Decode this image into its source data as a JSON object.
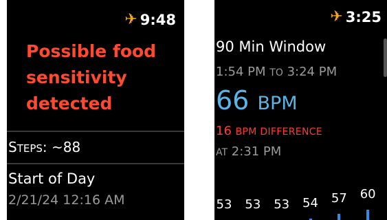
{
  "left": {
    "status_time": "9:48",
    "alert_line1": "Possible food",
    "alert_line2": "sensitivity",
    "alert_line3": "detected",
    "steps_label_first": "S",
    "steps_label_rest": "TEPS",
    "steps_value": ": ~88",
    "start_label": "Start of Day",
    "start_date": "2/21/24  12:16 AM"
  },
  "right": {
    "status_time": "3:25",
    "window_title": "90 Min Window",
    "range_start": "1:54 PM",
    "range_to": "TO",
    "range_end": "3:24 PM",
    "bpm_value": "66",
    "bpm_unit": "BPM",
    "diff_value": "16",
    "diff_label": "BPM DIFFERENCE",
    "at_label": "AT",
    "at_time": "2:31 PM",
    "accent_color": "#5ab4e6",
    "alert_color": "#ff3b30",
    "bars": [
      {
        "label": "53",
        "level": 0
      },
      {
        "label": "53",
        "level": 0
      },
      {
        "label": "53",
        "level": 0
      },
      {
        "label": "54",
        "level": 0.1
      },
      {
        "label": "57",
        "level": 0.4
      },
      {
        "label": "60",
        "level": 0.7
      }
    ]
  },
  "icons": {
    "status": "airplane-icon"
  }
}
